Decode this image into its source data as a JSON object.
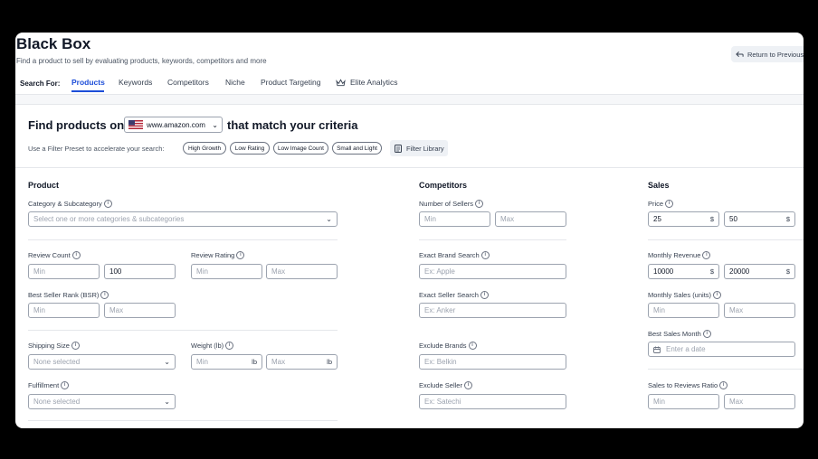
{
  "header": {
    "title": "Black Box",
    "subtitle": "Find a product to sell by evaluating products, keywords, competitors and more",
    "return_label": "Return to Previous"
  },
  "nav": {
    "search_for": "Search For:",
    "tabs": [
      "Products",
      "Keywords",
      "Competitors",
      "Niche",
      "Product Targeting",
      "Elite Analytics"
    ],
    "active": "Products"
  },
  "finder": {
    "prefix": "Find products on",
    "marketplace": "www.amazon.com",
    "suffix": "that match your criteria",
    "preset_label": "Use a Filter Preset to accelerate your search:",
    "presets": [
      "High Growth",
      "Low Rating",
      "Low Image Count",
      "Small and Light"
    ],
    "filter_library": "Filter Library"
  },
  "product": {
    "title": "Product",
    "category_label": "Category & Subcategory",
    "category_placeholder": "Select one or more categories & subcategories",
    "review_count_label": "Review Count",
    "review_count_min_ph": "Min",
    "review_count_max": "100",
    "review_rating_label": "Review Rating",
    "review_rating_min_ph": "Min",
    "review_rating_max_ph": "Max",
    "bsr_label": "Best Seller Rank (BSR)",
    "bsr_min_ph": "Min",
    "bsr_max_ph": "Max",
    "shipping_label": "Shipping Size",
    "shipping_value": "None selected",
    "weight_label": "Weight (lb)",
    "weight_min_ph": "Min",
    "weight_max_ph": "Max",
    "weight_unit": "lb",
    "fulfillment_label": "Fulfillment",
    "fulfillment_value": "None selected"
  },
  "competitors": {
    "title": "Competitors",
    "sellers_label": "Number of Sellers",
    "sellers_min_ph": "Min",
    "sellers_max_ph": "Max",
    "brand_label": "Exact Brand Search",
    "brand_ph": "Ex: Apple",
    "seller_label": "Exact Seller Search",
    "seller_ph": "Ex: Anker",
    "exclude_brands_label": "Exclude Brands",
    "exclude_brands_ph": "Ex: Belkin",
    "exclude_seller_label": "Exclude Seller",
    "exclude_seller_ph": "Ex: Satechi"
  },
  "sales": {
    "title": "Sales",
    "price_label": "Price",
    "price_min": "25",
    "price_max": "50",
    "currency": "$",
    "revenue_label": "Monthly Revenue",
    "revenue_min": "10000",
    "revenue_max": "20000",
    "units_label": "Monthly Sales (units)",
    "units_min_ph": "Min",
    "units_max_ph": "Max",
    "best_month_label": "Best Sales Month",
    "best_month_ph": "Enter a date",
    "ratio_label": "Sales to Reviews Ratio",
    "ratio_min_ph": "Min",
    "ratio_max_ph": "Max"
  },
  "colors": {
    "accent": "#1d4ed8",
    "border": "#9ca3af",
    "placeholder": "#9ca3af"
  },
  "icons": [
    "return-arrow-icon",
    "us-flag-icon",
    "chevron-down-icon",
    "crown-icon",
    "filter-library-icon",
    "info-icon",
    "calendar-icon"
  ]
}
